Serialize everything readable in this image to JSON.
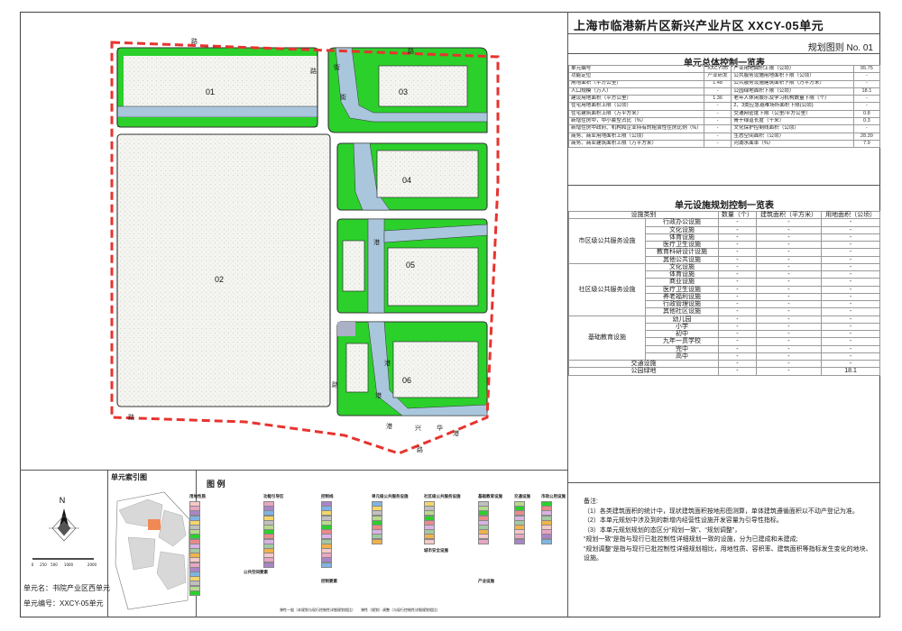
{
  "header": {
    "title": "上海市临港新片区新兴产业片区 XXCY-05单元",
    "sheet": "规划图则 No. 01"
  },
  "map": {
    "plots": [
      {
        "id": "01"
      },
      {
        "id": "02"
      },
      {
        "id": "03"
      },
      {
        "id": "04"
      },
      {
        "id": "05"
      },
      {
        "id": "06"
      }
    ],
    "road_chars": [
      "路",
      "路",
      "街",
      "街",
      "路",
      "港",
      "港",
      "路",
      "港",
      "港",
      "兴",
      "华",
      "港",
      "路",
      "路"
    ]
  },
  "summary_table": {
    "title": "单元总体控制一览表",
    "rows": [
      [
        "单元编号",
        "XXCY-05",
        "产业用地面积上限（公顷）",
        "95.75"
      ],
      [
        "功能定位",
        "产业研发",
        "公共服务设施用地面积下限（公顷）",
        "-"
      ],
      [
        "用地面积（平方公里）",
        "1.48",
        "公共服务设施建筑面积下限（万平方米）",
        "-"
      ],
      [
        "人口规模（万人）",
        "-",
        "公园绿地面积下限（公顷）",
        "18.1"
      ],
      [
        "建设用地面积（平方公里）",
        "1.36",
        "老年人休闲娱乐及学习机构数量下限（个）",
        "-"
      ],
      [
        "住宅用地面积上限（公顷）",
        "-",
        "2、3类应急避难场所面积下限(公顷)",
        "-"
      ],
      [
        "住宅建筑面积上限（万平方米）",
        "-",
        "交通网密度下限（公里/平方公里）",
        "0.8"
      ],
      [
        "新增住房中，中小套型占比（%）",
        "-",
        "骨干绿道长度（千米）",
        "0.3"
      ],
      [
        "新增住房中政府、机构和企业持有的租赁性住房比例（%）",
        "-",
        "文化保护控制线面积（公顷）",
        "-"
      ],
      [
        "商务、商业用地面积上限（公顷）",
        "-",
        "生态空间面积（公顷）",
        "28.39"
      ],
      [
        "商务、商业建筑面积上限（万平方米）",
        "-",
        "河湖水面率（%）",
        "7.9"
      ]
    ]
  },
  "facility_table": {
    "title": "单元设施规划控制一览表",
    "headers": [
      "设施类别",
      "数量（个）",
      "建筑面积（平方米）",
      "用地面积（公顷）"
    ],
    "groups": [
      {
        "name": "市区级公共服务设施",
        "items": [
          "行政办公设施",
          "文化设施",
          "体育设施",
          "医疗卫生设施",
          "教育科研设计设施",
          "其他公共设施"
        ]
      },
      {
        "name": "社区级公共服务设施",
        "items": [
          "文化设施",
          "体育设施",
          "商业设施",
          "医疗卫生设施",
          "养老福利设施",
          "行政管理设施",
          "其他社区设施"
        ]
      },
      {
        "name": "基础教育设施",
        "items": [
          "幼儿园",
          "小学",
          "初中",
          "九年一贯学校",
          "完中",
          "高中"
        ]
      }
    ],
    "extra_rows": [
      {
        "name": "交通设施",
        "values": [
          "-",
          "-",
          "-"
        ]
      },
      {
        "name": "公园绿地",
        "values": [
          "-",
          "-",
          "18.1"
        ]
      }
    ],
    "dash": "-"
  },
  "index_map": {
    "title": "单元索引图",
    "north": "N",
    "scale_ticks": [
      "0",
      "250",
      "500",
      "1000",
      "2000"
    ]
  },
  "legend": {
    "title": "图 例",
    "headers": [
      "用地性质",
      "功能引导区",
      "控制线",
      "单元级公共服务设施",
      "社区级公共服务设施",
      "基础教育设施",
      "交通设施",
      "市政公用设施"
    ],
    "sub_headers": [
      "公共空间要素",
      "控制要素",
      "城市安全设施",
      "产业设施"
    ],
    "footer_a": "弹性一般（本规划与现行控制性详细规划相比）",
    "footer_b": "弹性（规划）调整（与现行控制性详细规划相比）"
  },
  "unit_info": {
    "name": "单元名：书院产业区西单元",
    "code": "单元编号：XXCY-05单元"
  },
  "notes": {
    "title": "备注:",
    "lines": [
      "（1）各类建筑面积的统计中，现状建筑面积按地形图测算，单体建筑遵循面积以不动产登记为准。",
      "（2）本单元规划中涉及到的新增内经营性设施开发容量为引导性指标。",
      "（3）本单元规划规划的态区分“规划一致”、“规划调整”，",
      "“规划一致”是指与现行已批控制性详细规划一致的设施，分为已建成和未建成;",
      "“规划调整”是指与现行已批控制性详细规划相比，用地性质、容积率、建筑面积等指标发生变化的地块、设施。"
    ]
  },
  "colors": {
    "green": "#2bd02b",
    "river": "#a9c6dc",
    "plot": "#f3f3ef",
    "red": "#e8332e",
    "frame": "#444444"
  }
}
